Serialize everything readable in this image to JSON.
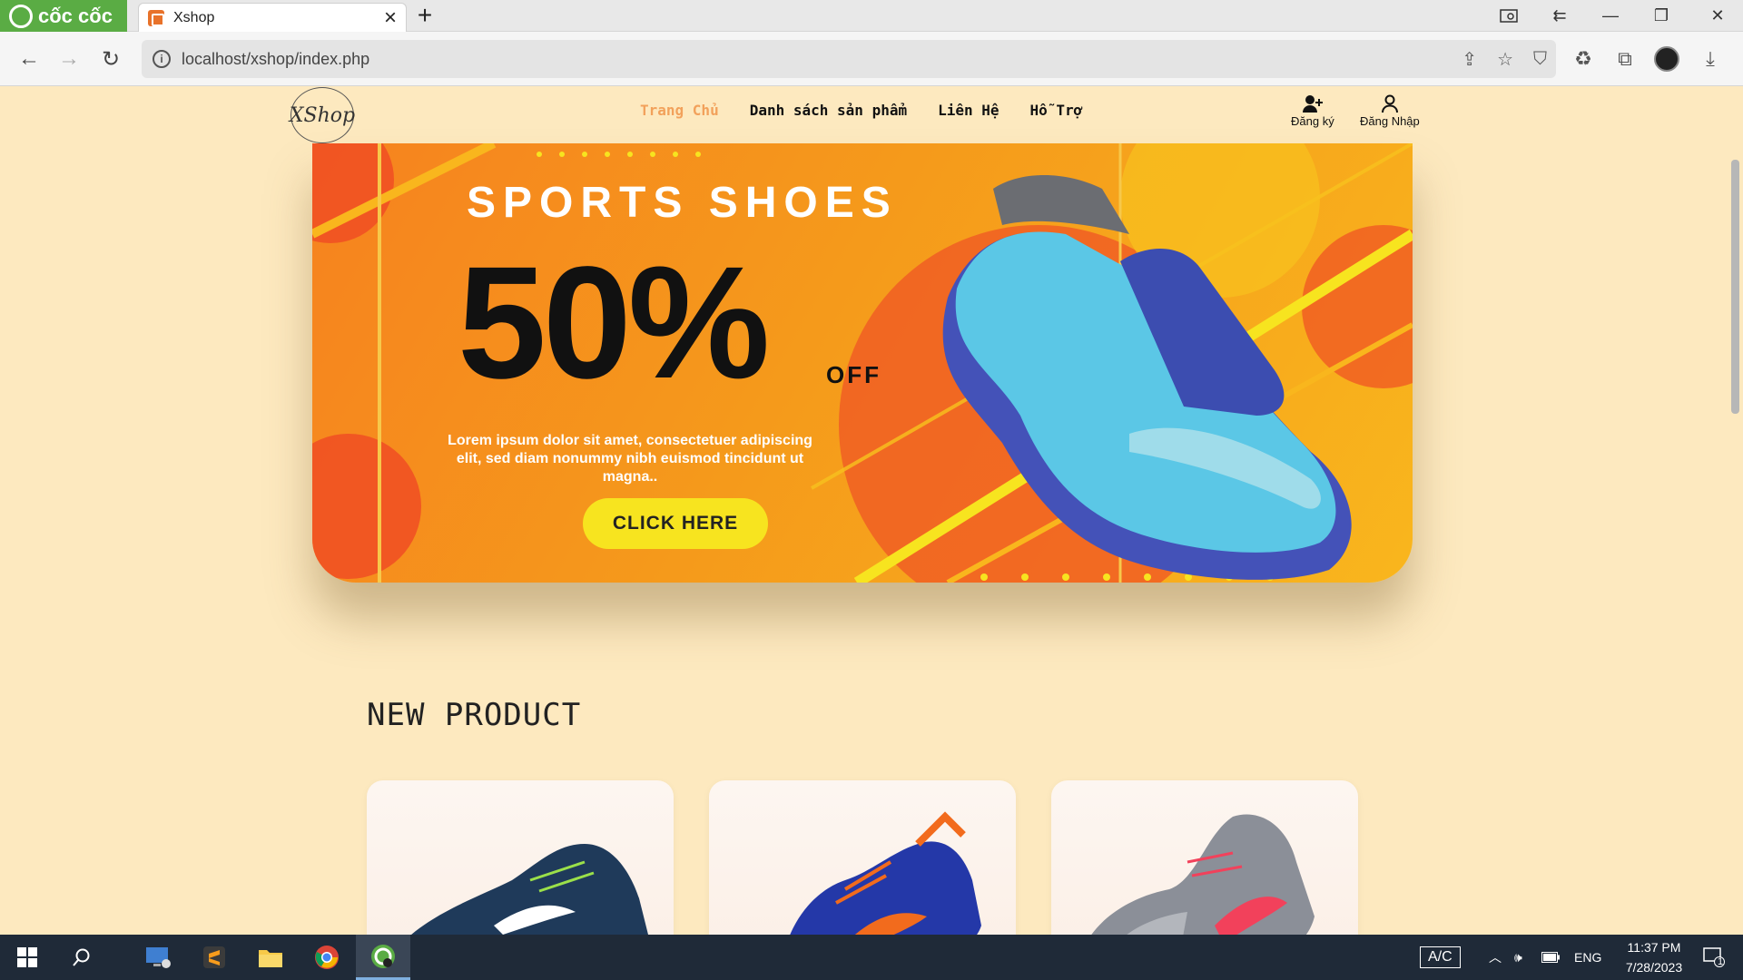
{
  "browser": {
    "brand": "cốc cốc",
    "tab_title": "Xshop",
    "url": "localhost/xshop/index.php"
  },
  "site": {
    "logo": "XShop",
    "nav": [
      "Trang Chủ",
      "Danh sách sản phẩm",
      "Liên Hệ",
      "Hỗ Trợ"
    ],
    "active_nav": "Trang Chủ",
    "register_label": "Đăng ký",
    "login_label": "Đăng Nhập"
  },
  "banner": {
    "title": "SPORTS SHOES",
    "discount": "50%",
    "off": "OFF",
    "description": "Lorem ipsum dolor sit amet, consectetuer adipiscing elit, sed diam nonummy nibh euismod tincidunt ut magna..",
    "button": "CLICK HERE"
  },
  "section": {
    "title": "NEW PRODUCT"
  },
  "products": [
    {
      "name": "shoe-blue-green",
      "color": "#1f3a5a"
    },
    {
      "name": "shoe-blue-orange",
      "color": "#2438a8"
    },
    {
      "name": "shoe-grey-pink",
      "color": "#8b8f98"
    }
  ],
  "taskbar": {
    "input_mode": "A/C",
    "language": "ENG",
    "time": "11:37 PM",
    "date": "7/28/2023",
    "notifications": "1"
  },
  "colors": {
    "page_bg": "#fde9bf",
    "accent_nav": "#f2a15b",
    "banner_orange": "#f6821f",
    "button_yellow": "#f7e41f"
  }
}
